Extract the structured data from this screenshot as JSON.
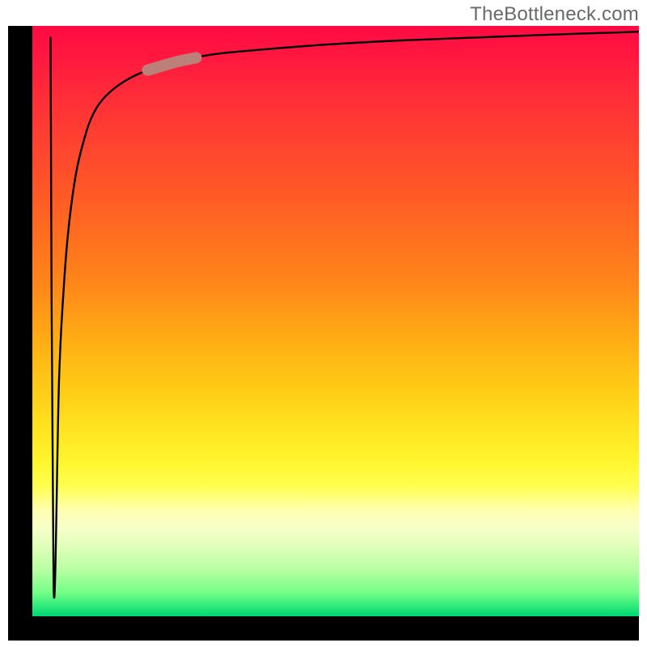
{
  "attribution": "TheBottleneck.com",
  "chart_data": {
    "type": "line",
    "title": "",
    "xlabel": "",
    "ylabel": "",
    "xlim": [
      0,
      1
    ],
    "ylim": [
      0,
      1
    ],
    "series": [
      {
        "name": "bottleneck-curve",
        "x": [
          0.03,
          0.035,
          0.044,
          0.052,
          0.06,
          0.072,
          0.086,
          0.1,
          0.12,
          0.15,
          0.19,
          0.24,
          0.3,
          0.38,
          0.48,
          0.6,
          0.75,
          0.88,
          1.0
        ],
        "values": [
          0.98,
          0.05,
          0.4,
          0.56,
          0.66,
          0.75,
          0.81,
          0.85,
          0.88,
          0.905,
          0.925,
          0.94,
          0.952,
          0.96,
          0.968,
          0.975,
          0.981,
          0.986,
          0.99
        ]
      }
    ],
    "annotations": [
      {
        "name": "marker-segment",
        "x_range": [
          0.19,
          0.27
        ],
        "desc": "salmon colored highlight segment on curve"
      }
    ],
    "background_gradient": {
      "top_color": "#ff0a43",
      "mid_color": "#ffe31f",
      "bottom_color": "#00d872"
    }
  },
  "colors": {
    "frame": "#000000",
    "curve": "#000000",
    "marker": "#bb8079",
    "attribution_text": "#666a6a"
  }
}
